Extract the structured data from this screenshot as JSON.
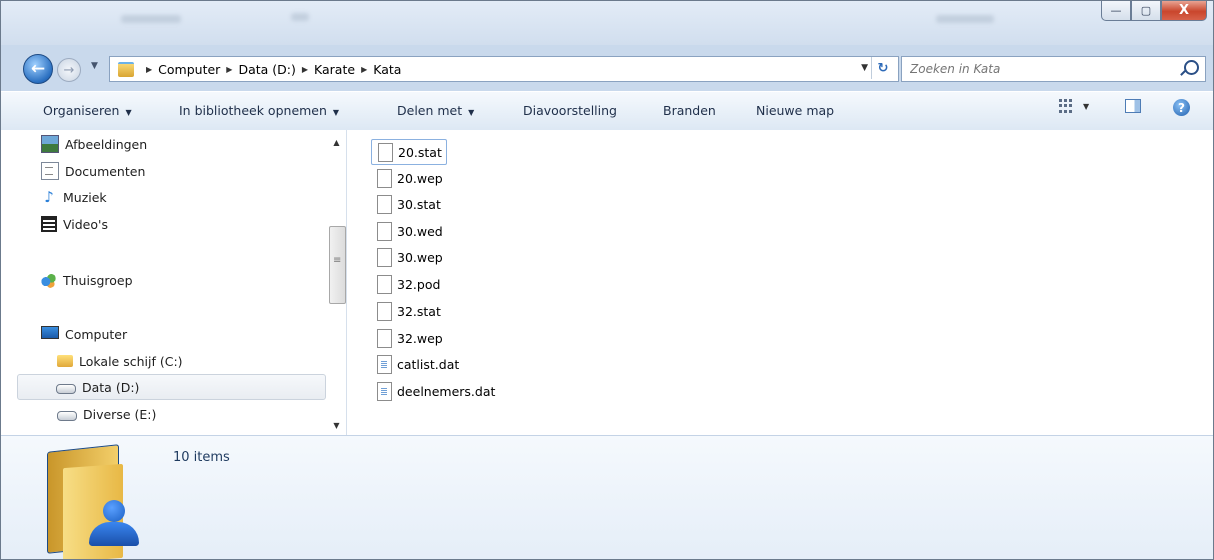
{
  "window": {
    "controls": {
      "minimize": "—",
      "maximize": "▢",
      "close": "X"
    }
  },
  "nav": {
    "back_icon": "back-arrow-icon",
    "breadcrumbs": [
      "Computer",
      "Data (D:)",
      "Karate",
      "Kata"
    ],
    "search_placeholder": "Zoeken in Kata"
  },
  "toolbar": {
    "organize": "Organiseren",
    "include_library": "In bibliotheek opnemen",
    "share_with": "Delen met",
    "slideshow": "Diavoorstelling",
    "burn": "Branden",
    "new_folder": "Nieuwe map"
  },
  "sidebar": {
    "items": [
      {
        "label": "Afbeeldingen",
        "icon": "pictures-icon"
      },
      {
        "label": "Documenten",
        "icon": "documents-icon"
      },
      {
        "label": "Muziek",
        "icon": "music-icon"
      },
      {
        "label": "Video's",
        "icon": "video-icon"
      },
      {
        "label": "Thuisgroep",
        "icon": "homegroup-icon"
      },
      {
        "label": "Computer",
        "icon": "computer-icon"
      },
      {
        "label": "Lokale schijf (C:)",
        "icon": "local-disk-icon"
      },
      {
        "label": "Data (D:)",
        "icon": "drive-icon",
        "selected": true
      },
      {
        "label": "Diverse (E:)",
        "icon": "drive-icon"
      }
    ]
  },
  "files": [
    {
      "name": "20.stat",
      "type": "blank"
    },
    {
      "name": "20.wep",
      "type": "blank"
    },
    {
      "name": "30.stat",
      "type": "blank"
    },
    {
      "name": "30.wed",
      "type": "blank"
    },
    {
      "name": "30.wep",
      "type": "blank"
    },
    {
      "name": "32.pod",
      "type": "blank"
    },
    {
      "name": "32.stat",
      "type": "blank"
    },
    {
      "name": "32.wep",
      "type": "blank"
    },
    {
      "name": "catlist.dat",
      "type": "dat"
    },
    {
      "name": "deelnemers.dat",
      "type": "dat"
    }
  ],
  "details": {
    "count": "10 items"
  }
}
